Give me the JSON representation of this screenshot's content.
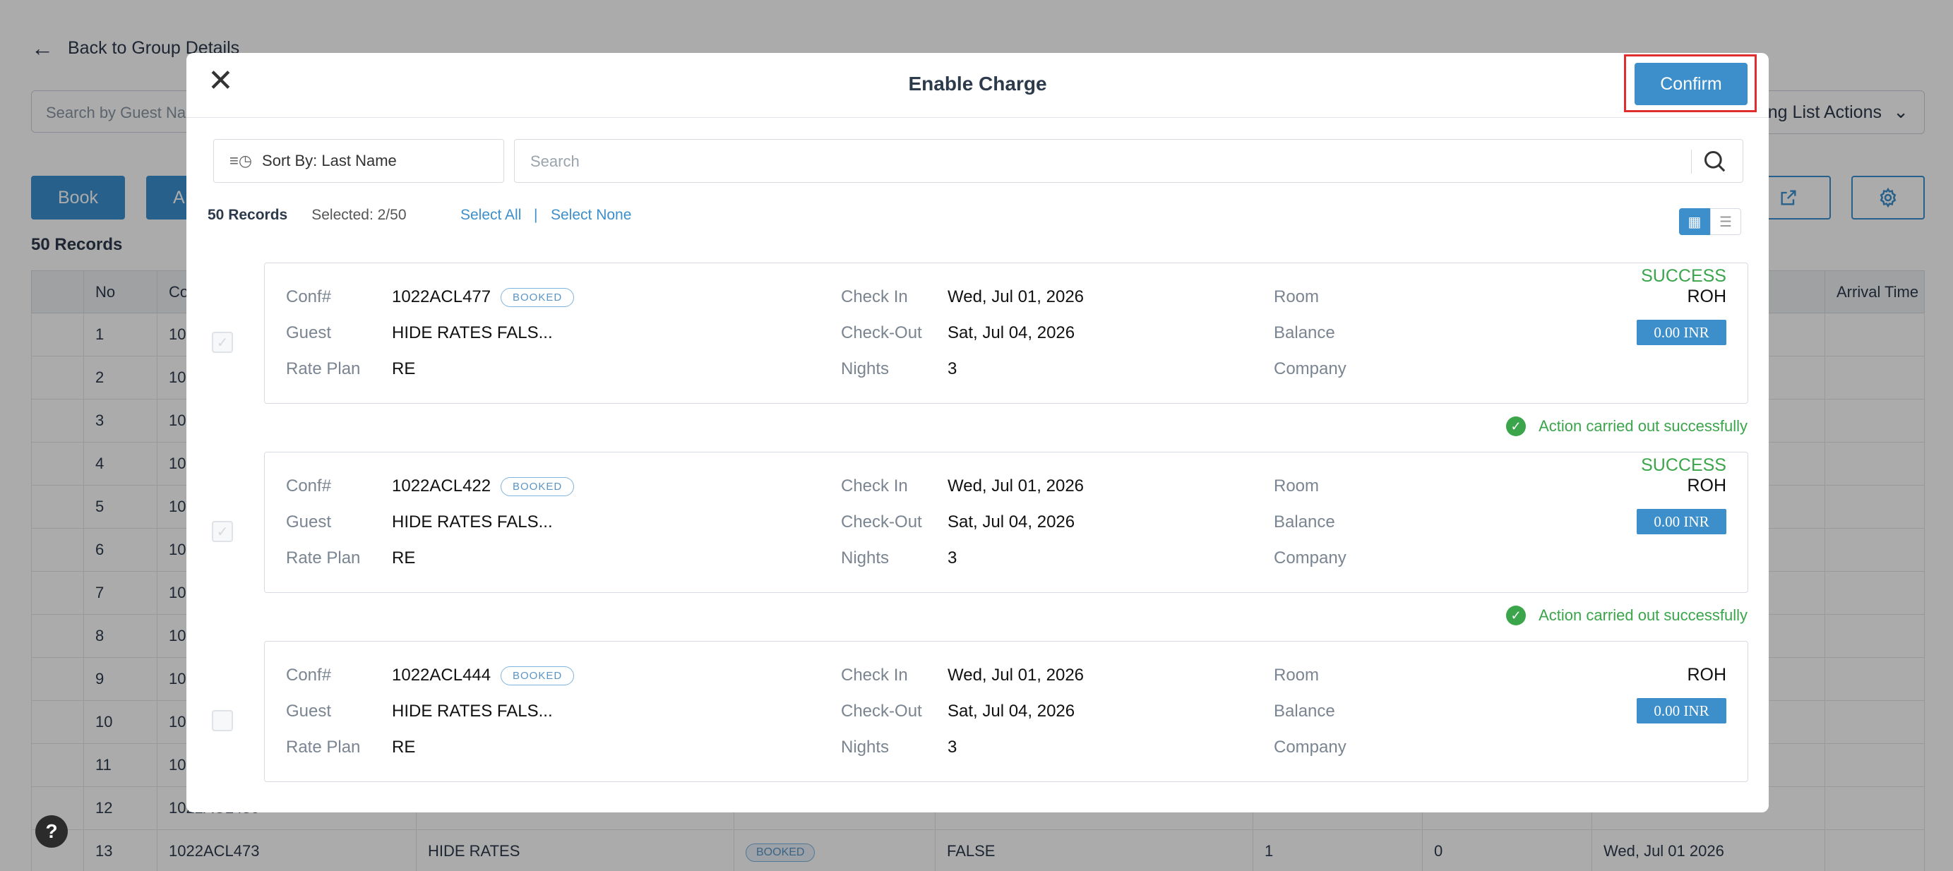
{
  "background": {
    "back_label": "Back to Group Details",
    "search_placeholder": "Search by Guest Nam",
    "actions_label": "ng List Actions",
    "book_label": "Book",
    "second_btn": "A",
    "records": "50 Records",
    "columns": [
      "",
      "No",
      "Co",
      "",
      "",
      "",
      "",
      "",
      "",
      "Arrival Time"
    ],
    "rows": [
      {
        "no": "1",
        "conf": "10"
      },
      {
        "no": "2",
        "conf": "10"
      },
      {
        "no": "3",
        "conf": "10"
      },
      {
        "no": "4",
        "conf": "10"
      },
      {
        "no": "5",
        "conf": "10"
      },
      {
        "no": "6",
        "conf": "10"
      },
      {
        "no": "7",
        "conf": "10"
      },
      {
        "no": "8",
        "conf": "10"
      },
      {
        "no": "9",
        "conf": "10"
      },
      {
        "no": "10",
        "conf": "10"
      },
      {
        "no": "11",
        "conf": "10"
      },
      {
        "no": "12",
        "conf": "1022ACL450"
      },
      {
        "no": "13",
        "conf": "1022ACL473",
        "guest": "HIDE RATES",
        "status": "BOOKED",
        "flag": "FALSE",
        "a": "1",
        "b": "0",
        "date": "Wed, Jul 01 2026"
      }
    ]
  },
  "modal": {
    "title": "Enable Charge",
    "confirm_label": "Confirm",
    "sort_label": "Sort By: Last Name",
    "search_placeholder": "Search",
    "records_count": "50 Records",
    "selected": "Selected: 2/50",
    "select_all": "Select All",
    "separator": "|",
    "select_none": "Select None"
  },
  "labels": {
    "conf": "Conf#",
    "guest": "Guest",
    "rate_plan": "Rate Plan",
    "check_in": "Check In",
    "check_out": "Check-Out",
    "nights": "Nights",
    "room": "Room",
    "balance": "Balance",
    "company": "Company"
  },
  "records": [
    {
      "conf": "1022ACL477",
      "status": "BOOKED",
      "guest": "HIDE RATES FALS...",
      "rate_plan": "RE",
      "check_in": "Wed, Jul 01, 2026",
      "check_out": "Sat, Jul 04, 2026",
      "nights": "3",
      "room": "ROH",
      "balance": "0.00 INR",
      "result": "SUCCESS",
      "message": "Action carried out successfully",
      "checked": true
    },
    {
      "conf": "1022ACL422",
      "status": "BOOKED",
      "guest": "HIDE RATES FALS...",
      "rate_plan": "RE",
      "check_in": "Wed, Jul 01, 2026",
      "check_out": "Sat, Jul 04, 2026",
      "nights": "3",
      "room": "ROH",
      "balance": "0.00 INR",
      "result": "SUCCESS",
      "message": "Action carried out successfully",
      "checked": true
    },
    {
      "conf": "1022ACL444",
      "status": "BOOKED",
      "guest": "HIDE RATES FALS...",
      "rate_plan": "RE",
      "check_in": "Wed, Jul 01, 2026",
      "check_out": "Sat, Jul 04, 2026",
      "nights": "3",
      "room": "ROH",
      "balance": "0.00 INR",
      "result": "",
      "message": "",
      "checked": false
    }
  ],
  "help_label": "?",
  "colors": {
    "accent": "#3d8fcc",
    "success": "#3aa54a",
    "highlight": "#e02d2d"
  }
}
